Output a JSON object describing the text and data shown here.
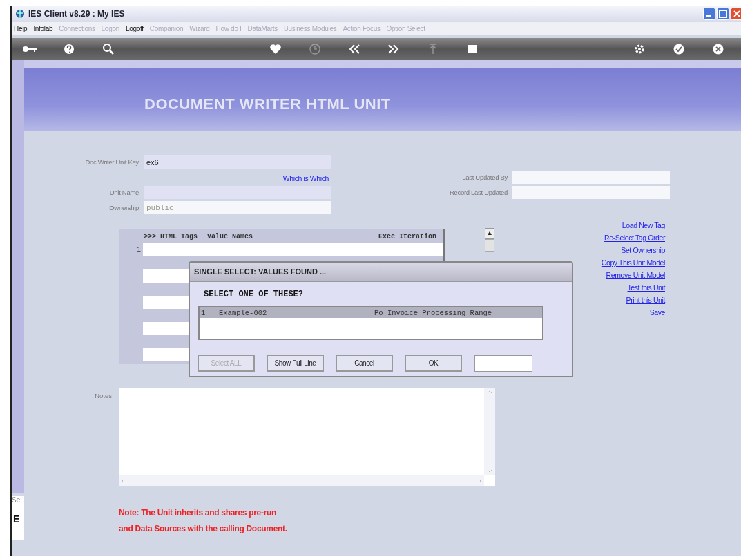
{
  "window": {
    "title": "IES Client v8.29 : My IES"
  },
  "menu": [
    {
      "label": "Help",
      "disabled": false
    },
    {
      "label": "Infolab",
      "disabled": false
    },
    {
      "label": "Connections",
      "disabled": true
    },
    {
      "label": "Logon",
      "disabled": true
    },
    {
      "label": "Logoff",
      "disabled": false
    },
    {
      "label": "Companion",
      "disabled": true
    },
    {
      "label": "Wizard",
      "disabled": true
    },
    {
      "label": "How do I",
      "disabled": true
    },
    {
      "label": "DataMarts",
      "disabled": true
    },
    {
      "label": "Business Modules",
      "disabled": true
    },
    {
      "label": "Action Focus",
      "disabled": true
    },
    {
      "label": "Option Select",
      "disabled": true
    }
  ],
  "toolbar": [
    {
      "kind": "key",
      "disabled": false
    },
    {
      "kind": "help",
      "disabled": false
    },
    {
      "kind": "search",
      "disabled": false
    },
    {
      "kind": "gap"
    },
    {
      "kind": "heart",
      "disabled": false
    },
    {
      "kind": "clock",
      "disabled": true
    },
    {
      "kind": "back",
      "disabled": false
    },
    {
      "kind": "forward",
      "disabled": false
    },
    {
      "kind": "up",
      "disabled": true
    },
    {
      "kind": "stop",
      "disabled": false
    },
    {
      "kind": "gap"
    },
    {
      "kind": "gear",
      "disabled": false
    },
    {
      "kind": "check",
      "disabled": false
    },
    {
      "kind": "close",
      "disabled": false
    }
  ],
  "side_panel": {
    "search_text": "Se",
    "glyph": "E"
  },
  "page": {
    "title": "DOCUMENT WRITER HTML UNIT"
  },
  "form": {
    "unit_key": {
      "label": "Doc Writer Unit Key",
      "value": "ex6",
      "editable": true
    },
    "which_link": "Which is Which",
    "unit_name": {
      "label": "Unit Name",
      "editable": true
    },
    "ownership": {
      "label": "Ownership",
      "value": "public",
      "editable": false
    },
    "last_updated_by": {
      "label": "Last Updated By",
      "editable": false
    },
    "record_last_updated": {
      "label": "Record Last Updated",
      "editable": false
    }
  },
  "grid": {
    "columns": [
      ">>> HTML Tags",
      "Value Names",
      "Exec Iteration"
    ],
    "rows": [
      {
        "number": "1"
      }
    ]
  },
  "links": [
    "Load New Tag",
    "Re-Select Tag Order",
    "Set Ownership",
    "Copy This Unit Model",
    "Remove Unit Model",
    "Test this Unit",
    "Print this Unit",
    "Save"
  ],
  "notes": {
    "label": "Notes"
  },
  "note_lines": [
    "Note: The Unit inherits and shares pre-run",
    "and Data Sources with the calling Document."
  ],
  "dialog": {
    "title": "SINGLE SELECT: VALUES FOUND ...",
    "prompt": "SELECT ONE OF THESE?",
    "items": [
      {
        "number": "1",
        "key": "Example-002",
        "description": "Po Invoice Processing Range",
        "selected": true
      }
    ],
    "buttons": [
      {
        "label": "Select ALL",
        "disabled": true
      },
      {
        "label": "Show Full Line",
        "disabled": false
      },
      {
        "label": "Cancel",
        "disabled": false
      },
      {
        "label": "OK",
        "disabled": false
      }
    ]
  }
}
